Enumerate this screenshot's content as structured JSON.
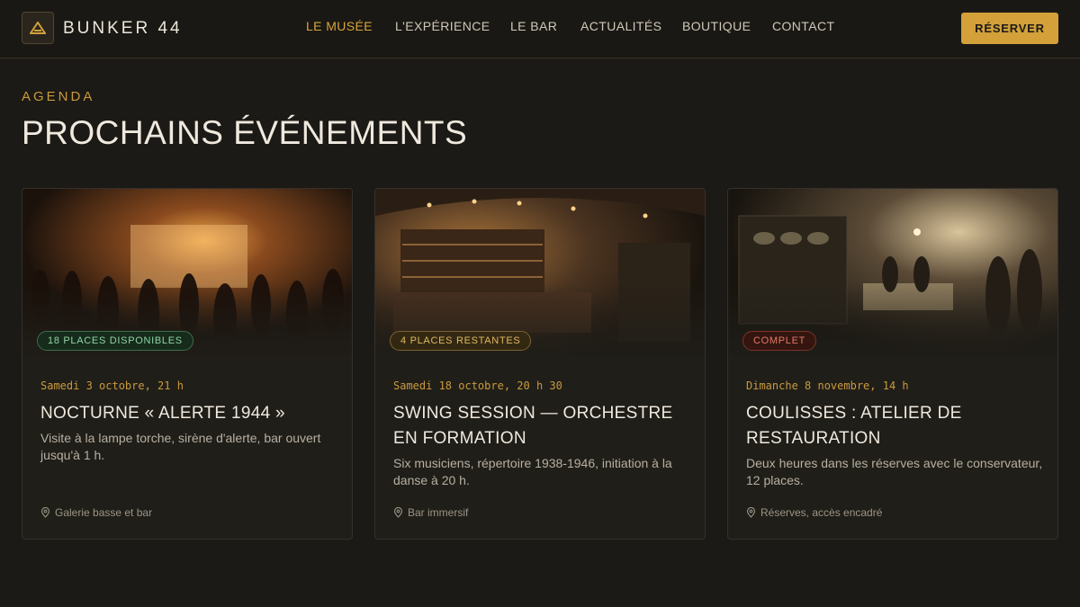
{
  "brand": {
    "name": "BUNKER 44",
    "logo_icon": "bunker-triangle-icon"
  },
  "nav": {
    "items": [
      {
        "label": "LE MUSÉE",
        "active": true
      },
      {
        "label": "L'EXPÉRIENCE"
      },
      {
        "label": "LE BAR"
      },
      {
        "label": "ACTUALITÉS"
      },
      {
        "label": "BOUTIQUE"
      },
      {
        "label": "CONTACT"
      }
    ],
    "cta_label": "RÉSERVER"
  },
  "section": {
    "eyebrow": "AGENDA",
    "title": "PROCHAINS ÉVÉNEMENTS"
  },
  "events": [
    {
      "badge": "18 PLACES DISPONIBLES",
      "badge_status": "available",
      "date": "Samedi 3 octobre, 21 h",
      "title": "NOCTURNE « ALERTE 1944 »",
      "description": "Visite à la lampe torche, sirène d'alerte, bar ouvert jusqu'à 1 h.",
      "location": "Galerie basse et bar",
      "image": "swing-dance-hall-photo"
    },
    {
      "badge": "4 PLACES RESTANTES",
      "badge_status": "limited",
      "date": "Samedi 18 octobre, 20 h 30",
      "title": "SWING SESSION — ORCHESTRE EN FORMATION",
      "description": "Six musiciens, répertoire 1938-1946, initiation à la danse à 20 h.",
      "location": "Bar immersif",
      "image": "speakeasy-bar-photo"
    },
    {
      "badge": "COMPLET",
      "badge_status": "full",
      "date": "Dimanche 8 novembre, 14 h",
      "title": "COULISSES : ATELIER DE RESTAURATION",
      "description": "Deux heures dans les réserves avec le conservateur, 12 places.",
      "location": "Réserves, accès encadré",
      "image": "restoration-workshop-photo"
    }
  ],
  "colors": {
    "background": "#1c1a16",
    "accent": "#d3a03a",
    "available": "#8fd3a4",
    "limited": "#e1b860",
    "full": "#e07a66"
  }
}
